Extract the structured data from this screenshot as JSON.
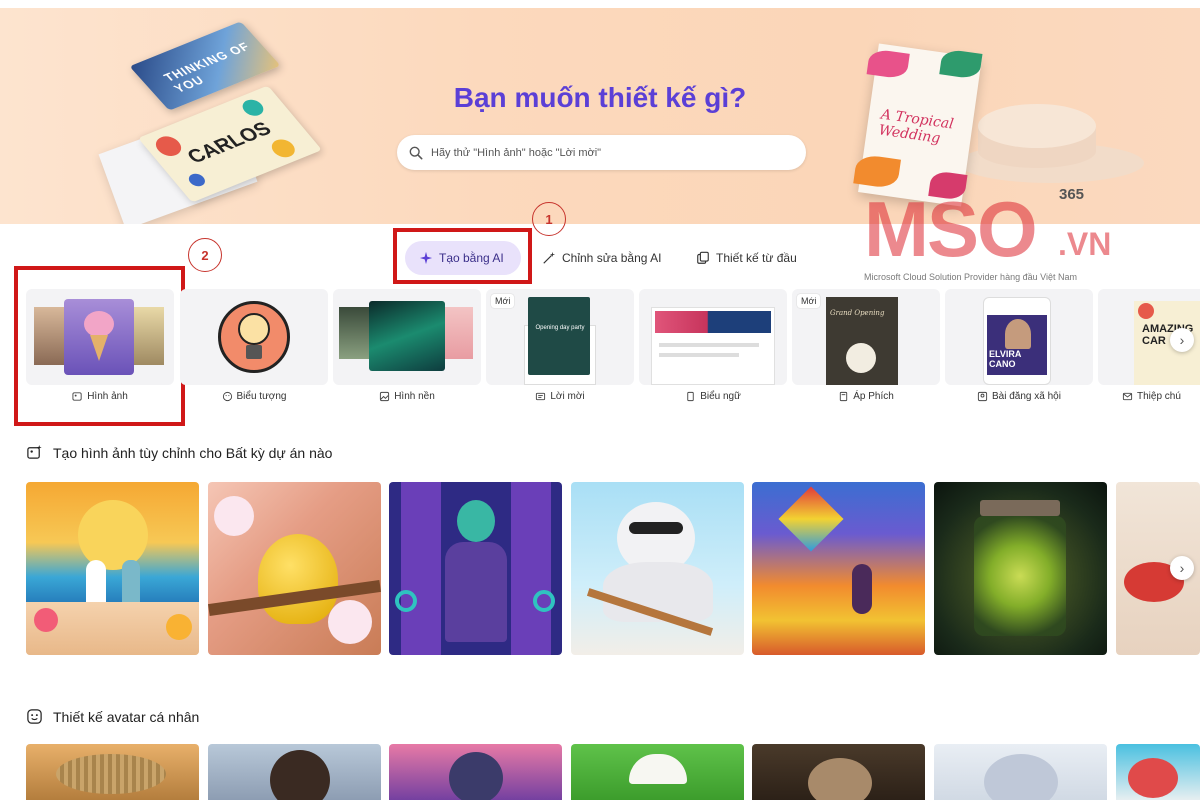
{
  "hero": {
    "title": "Bạn muốn thiết kế gì?",
    "search_placeholder": "Hãy thử \"Hình ảnh\" hoặc \"Lời mời\"",
    "card_blue_text": "THINKING OF YOU",
    "card_carlos_text": "CARLOS",
    "card_tropical_text": "A Tropical Wedding"
  },
  "watermark": {
    "brand": "MSO",
    "suffix": ".VN",
    "number": "365",
    "tagline": "Microsoft Cloud Solution Provider hàng đầu Việt Nam"
  },
  "tabs": [
    {
      "label": "Tạo bằng AI",
      "icon": "sparkle-icon",
      "active": true
    },
    {
      "label": "Chỉnh sửa bằng AI",
      "icon": "magic-wand-icon"
    },
    {
      "label": "Thiết kế từ đầu",
      "icon": "copy-pen-icon"
    }
  ],
  "annotations": {
    "one": "1",
    "two": "2"
  },
  "categories": [
    {
      "label": "Hình ảnh",
      "icon": "image-sparkle-icon",
      "new": ""
    },
    {
      "label": "Biểu tượng",
      "icon": "emoji-icon",
      "new": ""
    },
    {
      "label": "Hình nền",
      "icon": "wallpaper-icon",
      "new": ""
    },
    {
      "label": "Lời mời",
      "icon": "envelope-icon",
      "new": "Mới"
    },
    {
      "label": "Biểu ngữ",
      "icon": "banner-icon",
      "new": ""
    },
    {
      "label": "Áp Phích",
      "icon": "poster-icon",
      "new": "Mới"
    },
    {
      "label": "Bài đăng xã hội",
      "icon": "social-icon",
      "new": ""
    },
    {
      "label": "Thiệp chú",
      "icon": "card-icon",
      "new": ""
    }
  ],
  "category_tile_texts": {
    "invite_text": "Opening day party",
    "poster_text": "Grand Opening",
    "social_name": "ELVIRA CANO",
    "card_text": "AMAZING CAR"
  },
  "sections": {
    "custom_images_title": "Tạo hình ảnh tùy chỉnh cho Bất kỳ dự án nào",
    "avatar_title": "Thiết kế avatar cá nhân"
  },
  "colors": {
    "accent": "#5b3fd6",
    "highlight": "#d01818",
    "tab_active_bg": "#e9e2fb"
  }
}
